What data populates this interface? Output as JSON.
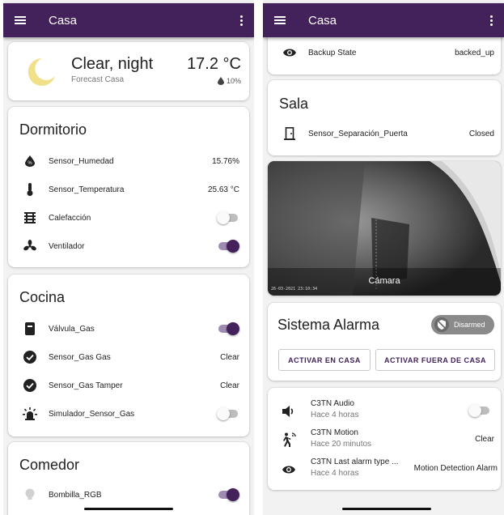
{
  "left": {
    "appbar": {
      "title": "Casa"
    },
    "weather": {
      "condition": "Clear, night",
      "source": "Forecast Casa",
      "temperature": "17.2 °C",
      "precipitation": "10%"
    },
    "dormitorio": {
      "title": "Dormitorio",
      "rows": [
        {
          "label": "Sensor_Humedad",
          "value": "15.76%"
        },
        {
          "label": "Sensor_Temperatura",
          "value": "25.63 °C"
        },
        {
          "label": "Calefacción",
          "state": "off"
        },
        {
          "label": "Ventilador",
          "state": "on"
        }
      ]
    },
    "cocina": {
      "title": "Cocina",
      "rows": [
        {
          "label": "Válvula_Gas",
          "state": "on"
        },
        {
          "label": "Sensor_Gas Gas",
          "value": "Clear"
        },
        {
          "label": "Sensor_Gas Tamper",
          "value": "Clear"
        },
        {
          "label": "Simulador_Sensor_Gas",
          "state": "off"
        }
      ]
    },
    "comedor": {
      "title": "Comedor",
      "rows": [
        {
          "label": "Bombilla_RGB",
          "state": "on"
        }
      ]
    }
  },
  "right": {
    "appbar": {
      "title": "Casa"
    },
    "backup": {
      "label": "Backup State",
      "value": "backed_up"
    },
    "sala": {
      "title": "Sala",
      "rows": [
        {
          "label": "Sensor_Separación_Puerta",
          "value": "Closed"
        }
      ]
    },
    "camera": {
      "name": "Cámara",
      "timestamp": "26-03-2021 23:10:34"
    },
    "alarm": {
      "title": "Sistema Alarma",
      "badge": "Disarmed",
      "arm_home": "ACTIVAR EN CASA",
      "arm_away": "ACTIVAR FUERA DE CASA"
    },
    "c3tn": {
      "rows": [
        {
          "label": "C3TN Audio",
          "sub": "Hace 4 horas",
          "state": "off"
        },
        {
          "label": "C3TN Motion",
          "sub": "Hace 20 minutos",
          "value": "Clear"
        },
        {
          "label": "C3TN Last alarm type ...",
          "sub": "Hace 4 horas",
          "value": "Motion Detection Alarm"
        }
      ]
    }
  },
  "colors": {
    "appbar": "#43215a",
    "accent": "#43215a",
    "moon": "#f0e08a"
  }
}
